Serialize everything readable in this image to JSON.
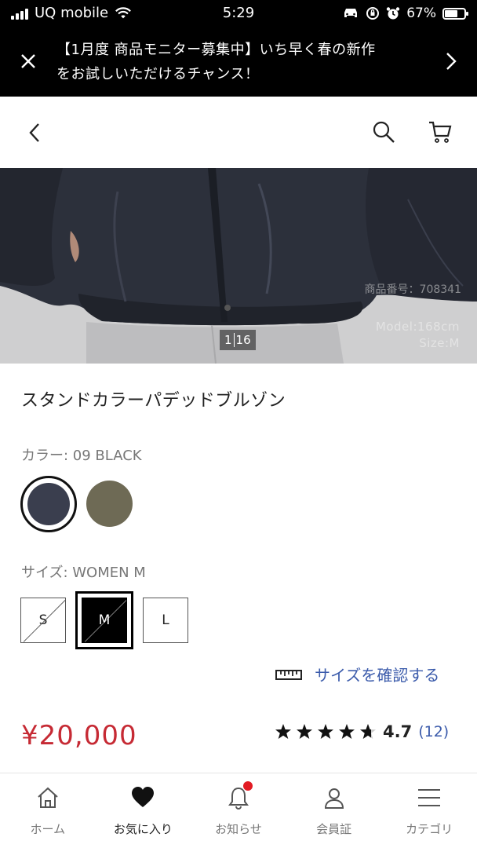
{
  "status_bar": {
    "carrier": "UQ mobile",
    "time": "5:29",
    "battery": "67%",
    "battery_level": 0.67
  },
  "banner": {
    "line1": "【1月度 商品モニター募集中】いち早く春の新作",
    "line2": "をお試しいただけるチャンス！"
  },
  "header": {
    "icons": [
      "back-icon",
      "search-icon",
      "cart-icon"
    ]
  },
  "hero": {
    "product_number": "商品番号：708341",
    "model_height": "Model:168cm",
    "model_size": "Size:M",
    "pager_current": "1",
    "pager_total": "16"
  },
  "product": {
    "title": "スタンドカラーパデッドブルゾン",
    "color_label": "カラー: 09 BLACK",
    "colors": [
      {
        "name": "BLACK",
        "hex": "#3a3e4e",
        "selected": true
      },
      {
        "name": "OLIVE",
        "hex": "#6e6a55",
        "selected": false
      }
    ],
    "size_label": "サイズ: WOMEN M",
    "sizes": [
      {
        "label": "S",
        "selected": false,
        "available": false
      },
      {
        "label": "M",
        "selected": true,
        "available": false
      },
      {
        "label": "L",
        "selected": false,
        "available": true
      }
    ],
    "size_check_link": "サイズを確認する",
    "price": "¥20,000",
    "rating_score": "4.7",
    "rating_value": 4.7,
    "rating_count": "(12)"
  },
  "colors": {
    "price_red": "#c62a34",
    "link_blue": "#3b5bab",
    "badge_red": "#e21b23"
  },
  "bottom_nav": {
    "items": [
      {
        "label": "ホーム",
        "icon": "home-icon"
      },
      {
        "label": "お気に入り",
        "icon": "heart-icon",
        "active": true
      },
      {
        "label": "お知らせ",
        "icon": "bell-icon",
        "badge": true
      },
      {
        "label": "会員証",
        "icon": "person-icon"
      },
      {
        "label": "カテゴリ",
        "icon": "menu-icon"
      }
    ]
  }
}
